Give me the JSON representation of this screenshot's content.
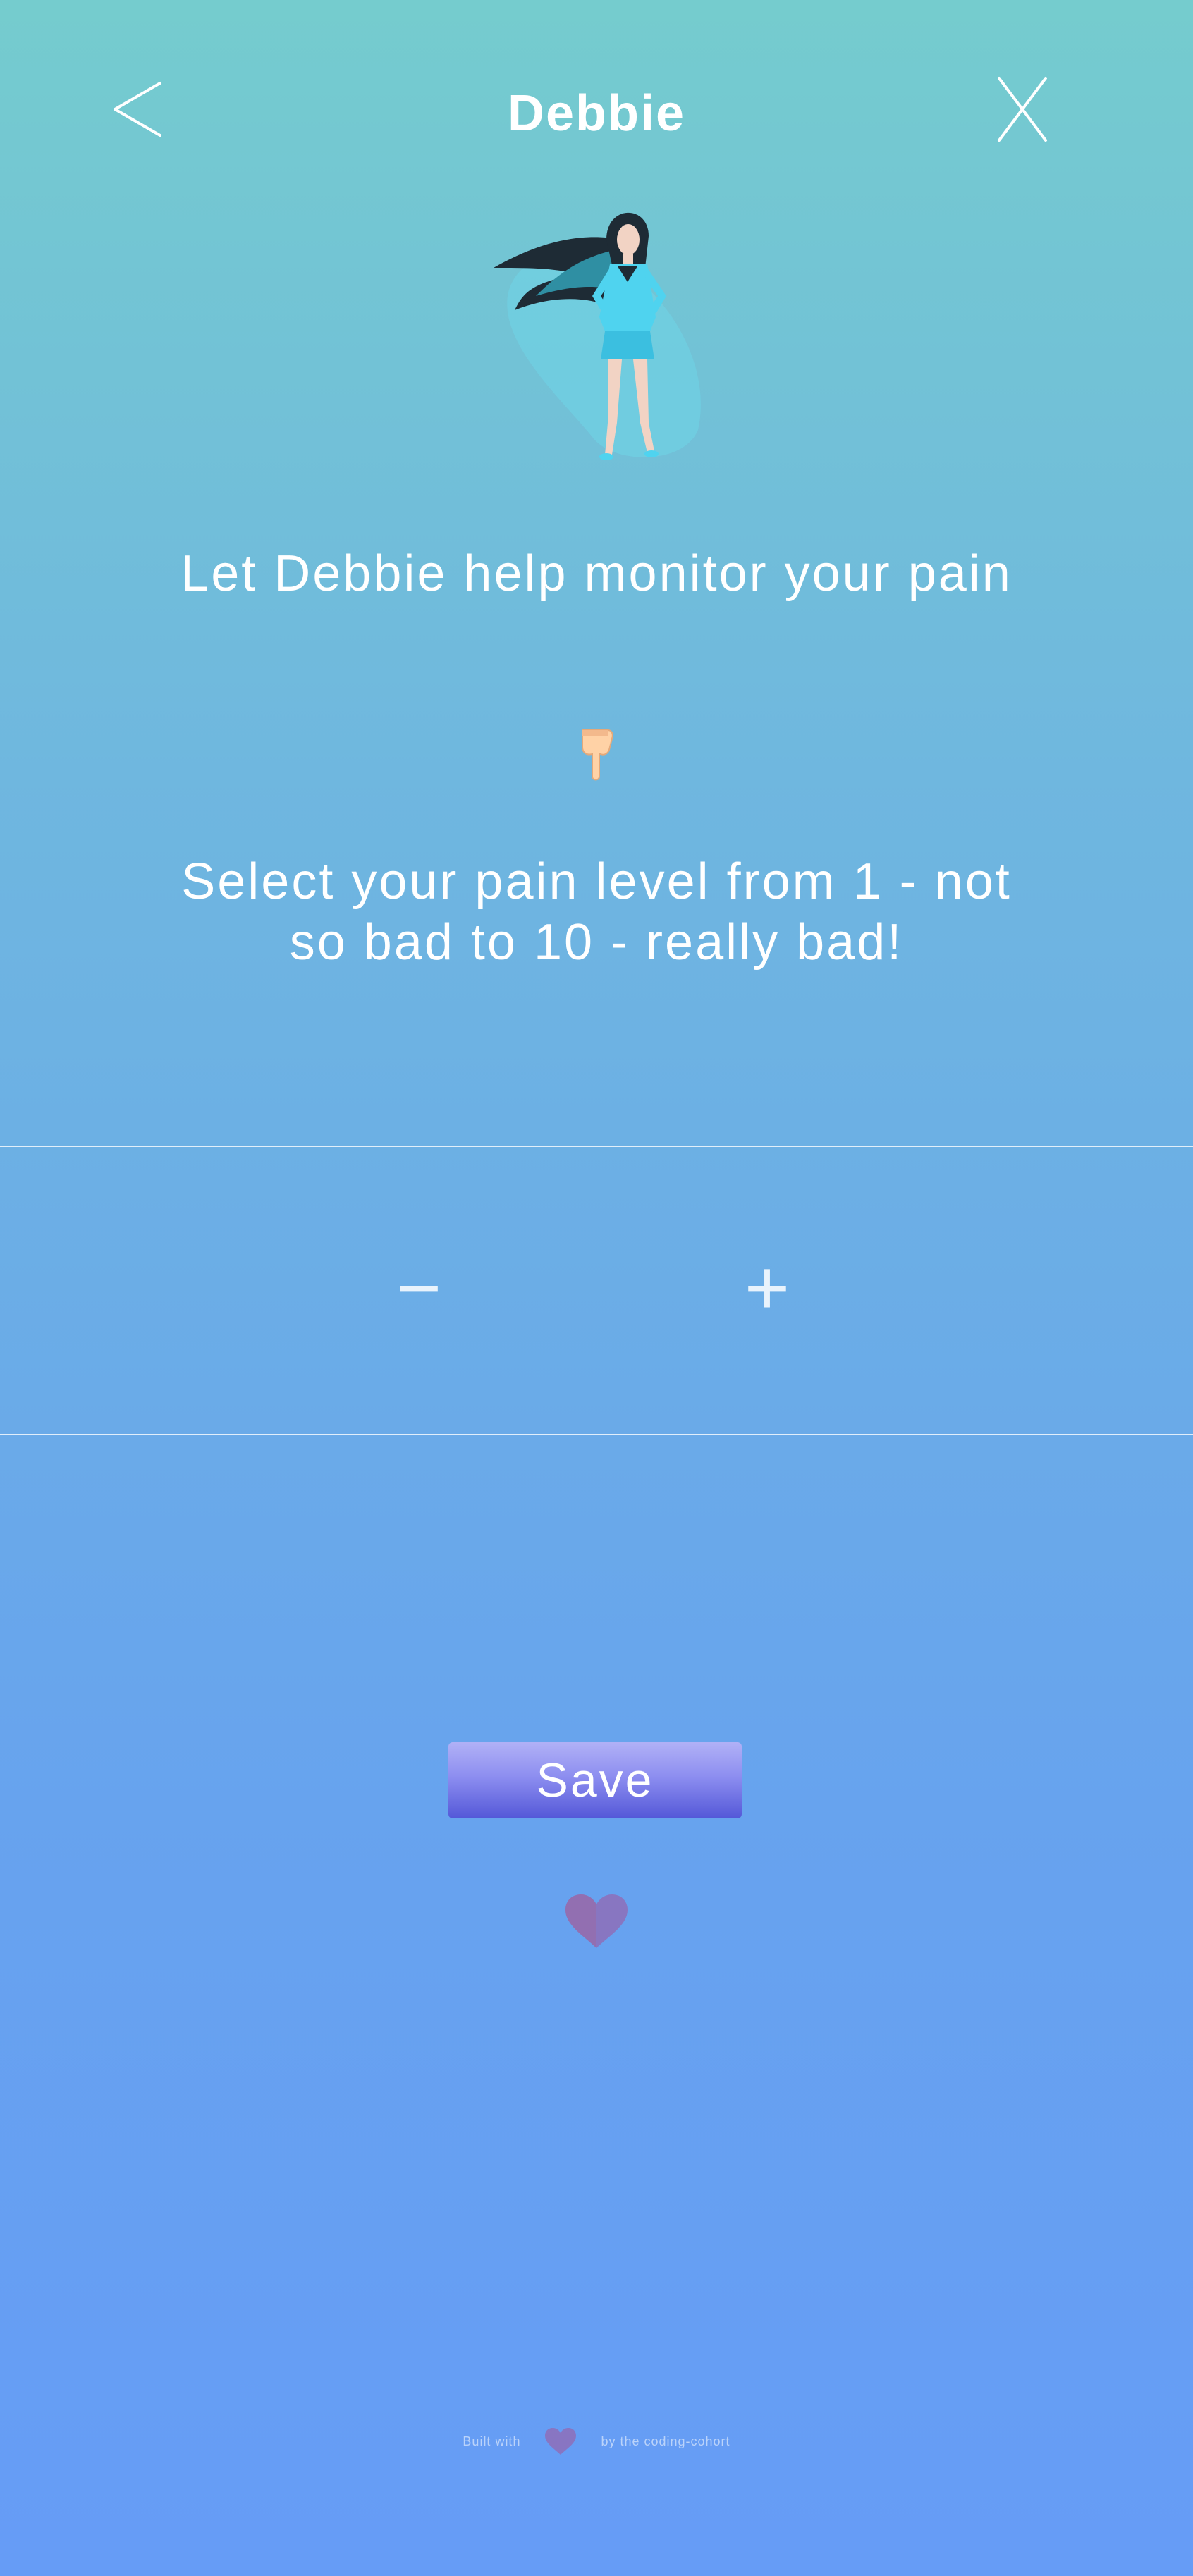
{
  "header": {
    "title": "Debbie",
    "back_icon": "chevron-left-icon",
    "close_icon": "close-x-icon"
  },
  "hero": {
    "illustration": "superhero-woman-illustration"
  },
  "prompt": {
    "headline": "Let Debbie help monitor your pain",
    "pointer_emoji": "👇",
    "instruction": "Select your pain level from 1 - not so bad to 10 - really bad!"
  },
  "stepper": {
    "minus_label": "−",
    "plus_label": "+",
    "value": ""
  },
  "actions": {
    "save_label": "Save"
  },
  "footer": {
    "prefix": "Built with",
    "suffix": "by the coding-cohort"
  },
  "colors": {
    "background_top": "#75ccce",
    "background_bottom": "#669cf6",
    "save_button_top": "#b1b1f6",
    "save_button_bottom": "#5458d8",
    "heart": "#8e6fb8"
  }
}
